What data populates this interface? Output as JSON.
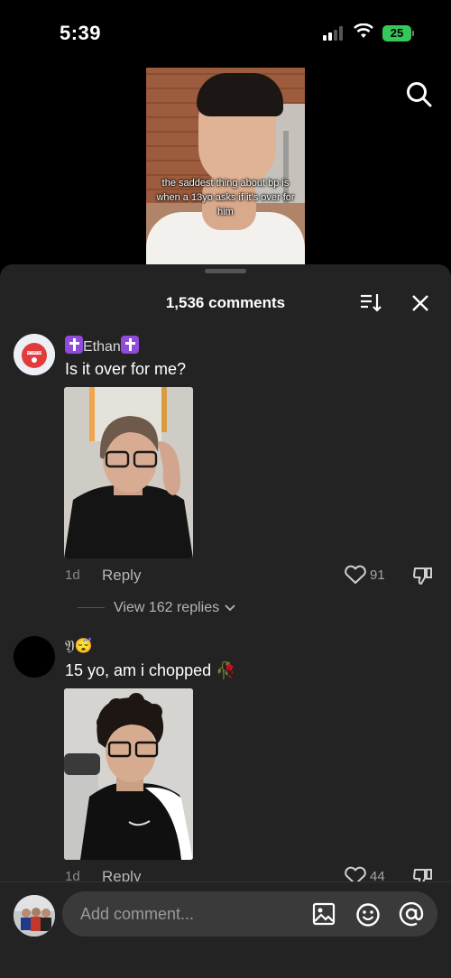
{
  "status_bar": {
    "time": "5:39",
    "battery": "25"
  },
  "video": {
    "caption": "the saddest thing about bp is when a 13yo asks if it's over for him"
  },
  "sheet": {
    "comment_count": "1,536 comments"
  },
  "comments": [
    {
      "username": "Ethan",
      "avatar_text": "Arsenal",
      "text": "Is it over for me?",
      "age": "1d",
      "reply_label": "Reply",
      "likes": "91",
      "view_replies": "View 162 replies"
    },
    {
      "username": "𝔜😴",
      "text": "15 yo, am i chopped 🥀",
      "age": "1d",
      "reply_label": "Reply",
      "likes": "44"
    }
  ],
  "composer": {
    "placeholder": "Add comment..."
  },
  "icons": [
    "search-icon",
    "sort-icon",
    "close-icon",
    "heart-icon",
    "dislike-icon",
    "chevron-down-icon",
    "image-icon",
    "emoji-icon",
    "at-icon"
  ]
}
